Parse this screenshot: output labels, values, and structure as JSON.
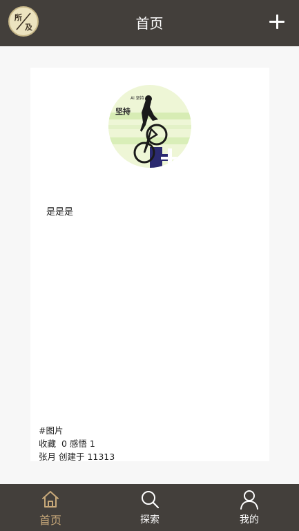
{
  "header": {
    "logo_char1": "所",
    "logo_char2": "及",
    "title": "首页",
    "add_icon": "plus-icon"
  },
  "card": {
    "image_text_large": "坚持",
    "image_text_small": "Ai 坚持",
    "body": "是是是",
    "tag": "#图片",
    "stats": "收藏  0 感悟 1",
    "meta": "张月 创建于 11313"
  },
  "tabbar": {
    "items": [
      {
        "label": "首页",
        "icon": "home-icon",
        "active": true
      },
      {
        "label": "探索",
        "icon": "search-icon",
        "active": false
      },
      {
        "label": "我的",
        "icon": "user-icon",
        "active": false
      }
    ]
  },
  "colors": {
    "header_bg": "#433f3b",
    "page_bg": "#f7f7f7",
    "active_tab": "#c8a97a",
    "logo_bg": "#ece3bf"
  }
}
